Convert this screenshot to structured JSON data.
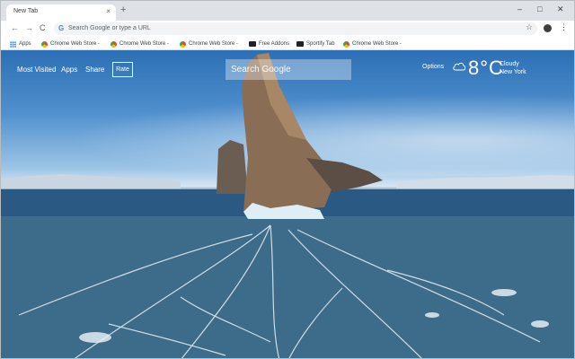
{
  "browser": {
    "tab_title": "New Tab",
    "tab_close": "×",
    "new_tab": "+",
    "window_controls": {
      "minimize": "–",
      "maximize": "□",
      "close": "✕"
    }
  },
  "toolbar": {
    "back": "←",
    "forward": "→",
    "reload": "C",
    "omnibox_placeholder": "Search Google or type a URL",
    "bookmark_star": "☆",
    "menu": "⋮"
  },
  "bookmarks": [
    {
      "label": "Apps",
      "icon": "apps-grid-icon"
    },
    {
      "label": "Chrome Web Store -",
      "icon": "chrome-web-store-icon"
    },
    {
      "label": "Chrome Web Store -",
      "icon": "chrome-web-store-icon"
    },
    {
      "label": "Chrome Web Store -",
      "icon": "chrome-web-store-icon"
    },
    {
      "label": "Free Addons",
      "icon": "tv-icon"
    },
    {
      "label": "Sportify Tab",
      "icon": "tv-icon"
    },
    {
      "label": "Chrome Web Store -",
      "icon": "chrome-web-store-icon"
    }
  ],
  "newtab": {
    "links": {
      "most_visited": "Most Visited",
      "apps": "Apps",
      "share": "Share",
      "rate": "Rate"
    },
    "search_placeholder": "Search Google",
    "options": "Options",
    "weather": {
      "temperature": "8°C",
      "condition": "Cloudy",
      "city": "New York",
      "icon": "cloud-icon"
    }
  },
  "colors": {
    "tab_strip": "#dee1e6",
    "omnibox": "#f1f3f4",
    "google_blue": "#4285f4"
  }
}
